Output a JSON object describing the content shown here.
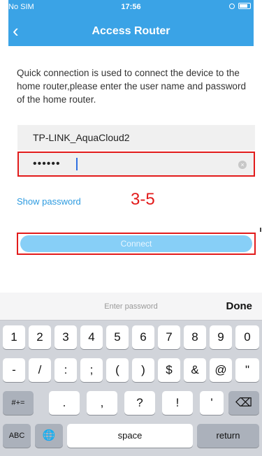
{
  "status": {
    "carrier": "No SIM",
    "time": "17:56"
  },
  "nav": {
    "back": "‹",
    "title": "Access Router"
  },
  "description": "Quick connection is used to connect the device to the home router,please enter the user name and password of the home router.",
  "ssid_value": "TP-LINK_AquaCloud2",
  "password_value": "••••••",
  "clear_icon": "⊗",
  "show_password": "Show password",
  "annotation": "3-5",
  "connect_label": "Connect",
  "keyboard": {
    "placeholder": "Enter password",
    "done": "Done",
    "row1": [
      "1",
      "2",
      "3",
      "4",
      "5",
      "6",
      "7",
      "8",
      "9",
      "0"
    ],
    "row2": [
      "-",
      "/",
      ":",
      ";",
      "(",
      ")",
      "$",
      "&",
      "@",
      "\""
    ],
    "row3": [
      ".",
      ",",
      "?",
      "!",
      "'"
    ],
    "shift_label": "#+=",
    "backspace": "⌫",
    "abc": "ABC",
    "globe": "🌐",
    "space": "space",
    "return": "return"
  },
  "colors": {
    "nav_blue": "#3aa3e6",
    "highlight_red": "#e21b1b",
    "button_blue": "#87cff7"
  }
}
